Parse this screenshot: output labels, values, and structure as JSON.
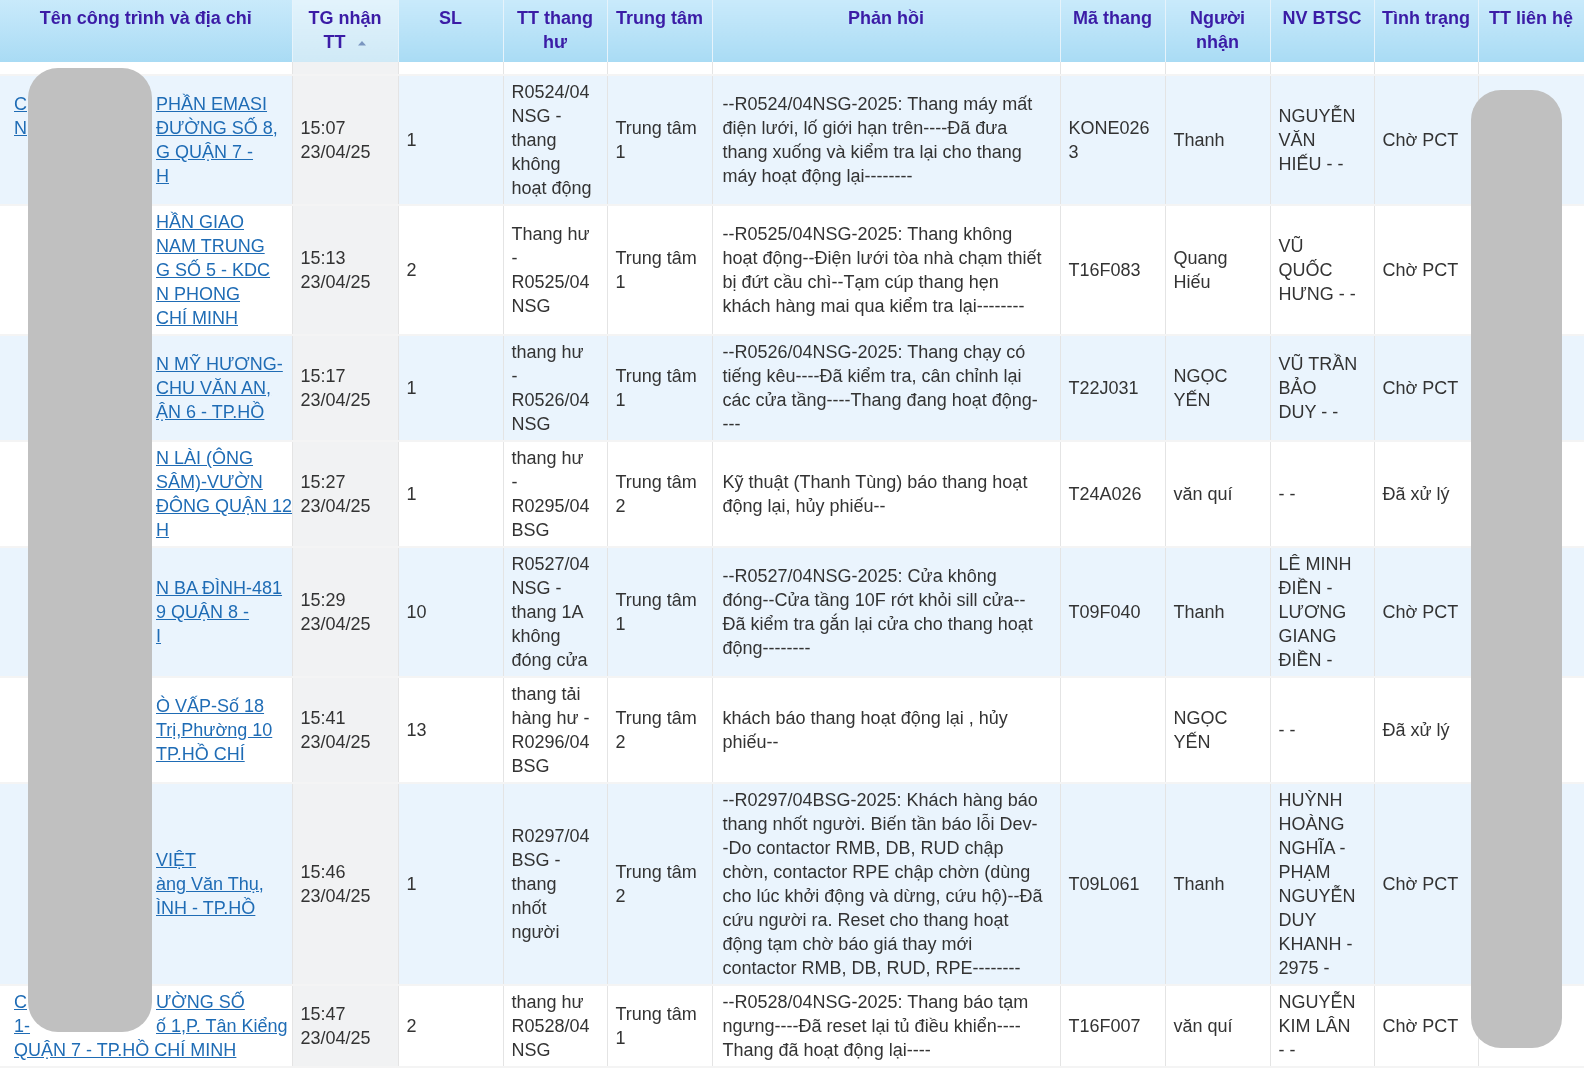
{
  "table": {
    "columns": [
      {
        "label": "Tên công trình và địa chỉ"
      },
      {
        "label": "TG nhận TT",
        "sorted": true
      },
      {
        "label": "SL"
      },
      {
        "label": "TT thang hư"
      },
      {
        "label": "Trung tâm"
      },
      {
        "label": "Phản hồi"
      },
      {
        "label": "Mã thang"
      },
      {
        "label": "Người nhận"
      },
      {
        "label": "NV BTSC"
      },
      {
        "label": "Tình trạng"
      },
      {
        "label": "TT liên hệ"
      }
    ],
    "rows": [
      {
        "address_lines": [
          {
            "left": "C",
            "right": "PHẦN EMASI"
          },
          {
            "left": "N",
            "right": "ĐƯỜNG SỐ 8,"
          },
          {
            "right": "G QUẬN 7 -"
          },
          {
            "right": "H"
          }
        ],
        "received": "15:07 23/04/25",
        "qty": "1",
        "elevator_status": "R0524/04 NSG - thang không hoạt động",
        "center": "Trung tâm 1",
        "feedback": "--R0524/04NSG-2025: Thang máy mất điện lưới, lố giới hạn trên----Đã đưa thang xuống và kiểm tra lại cho thang máy hoạt động lại--------",
        "elevator_code": "KONE0263",
        "receiver": "Thanh",
        "staff": "NGUYỄN VĂN HIẾU - -",
        "status": "Chờ PCT"
      },
      {
        "address_lines": [
          {
            "right": "HẦN GIAO"
          },
          {
            "right": "NAM TRUNG"
          },
          {
            "right": "G SỐ 5 - KDC"
          },
          {
            "right": "N PHONG"
          },
          {
            "right": "CHÍ MINH"
          }
        ],
        "received": "15:13 23/04/25",
        "qty": "2",
        "elevator_status": "Thang hư - R0525/04 NSG",
        "center": "Trung tâm 1",
        "feedback": "--R0525/04NSG-2025: Thang không hoạt động--Điện lưới tòa nhà chạm thiết bị đứt cầu chì--Tạm cúp thang hẹn khách hàng mai qua kiểm tra lại--------",
        "elevator_code": "T16F083",
        "receiver": "Quang Hiếu",
        "staff": "VŨ QUỐC HƯNG - -",
        "status": "Chờ PCT"
      },
      {
        "address_lines": [
          {
            "right": "N MỸ HƯƠNG-"
          },
          {
            "right": "CHU VĂN AN,"
          },
          {
            "right": "ẬN 6 - TP.HỒ"
          }
        ],
        "received": "15:17 23/04/25",
        "qty": "1",
        "elevator_status": "thang hư - R0526/04 NSG",
        "center": "Trung tâm 1",
        "feedback": "--R0526/04NSG-2025: Thang chạy có tiếng kêu----Đã kiểm tra, cân chỉnh lại các cửa tầng----Thang đang hoạt động----",
        "elevator_code": "T22J031",
        "receiver": "NGỌC YẾN",
        "staff": "VŨ TRẦN BẢO DUY - -",
        "status": "Chờ PCT"
      },
      {
        "address_lines": [
          {
            "right": "N LÀI (ÔNG"
          },
          {
            "right": "SÂM)-VƯỜN"
          },
          {
            "right": "ĐÔNG QUẬN 12"
          },
          {
            "right": "H"
          }
        ],
        "received": "15:27 23/04/25",
        "qty": "1",
        "elevator_status": "thang hư - R0295/04 BSG",
        "center": "Trung tâm 2",
        "feedback": "Kỹ thuật (Thanh Tùng) báo thang hoạt động lại, hủy phiếu--",
        "elevator_code": "T24A026",
        "receiver": "văn quí",
        "staff": "- -",
        "status": "Đã xử lý"
      },
      {
        "address_lines": [
          {
            "right": "N BA ĐÌNH-481"
          },
          {
            "right": "9 QUẬN 8 -"
          },
          {
            "right": "I"
          }
        ],
        "received": "15:29 23/04/25",
        "qty": "10",
        "elevator_status": "R0527/04 NSG - thang 1A không đóng cửa",
        "center": "Trung tâm 1",
        "feedback": "--R0527/04NSG-2025: Cửa không đóng--Cửa tầng 10F rớt khỏi sill cửa--Đã kiểm tra gắn lại cửa cho thang hoạt động--------",
        "elevator_code": "T09F040",
        "receiver": "Thanh",
        "staff": "LÊ MINH ĐIỀN - LƯƠNG GIANG ĐIỀN -",
        "status": "Chờ PCT"
      },
      {
        "address_lines": [
          {
            "right": "Ò VẤP-Số 18"
          },
          {
            "right": "Trị,Phường 10"
          },
          {
            "right": "TP.HỒ CHÍ"
          }
        ],
        "received": "15:41 23/04/25",
        "qty": "13",
        "elevator_status": "thang tải hàng hư - R0296/04 BSG",
        "center": "Trung tâm 2",
        "feedback": "khách báo thang hoạt động lại , hủy phiếu--",
        "receiver": "NGỌC YẾN",
        "staff": "- -",
        "status": "Đã xử lý"
      },
      {
        "address_lines": [
          {
            "right": "VIỆT"
          },
          {
            "right": "àng Văn Thụ,"
          },
          {
            "right": "ÌNH - TP.HỒ"
          }
        ],
        "received": "15:46 23/04/25",
        "qty": "1",
        "elevator_status": "R0297/04 BSG - thang nhốt người",
        "center": "Trung tâm 2",
        "feedback": "--R0297/04BSG-2025: Khách hàng báo thang nhốt người. Biến tần báo lỗi Dev--Do contactor RMB, DB, RUD chập chờn, contactor RPE chập chờn (dùng cho lúc khởi động và dừng, cứu hộ)--Đã cứu người ra. Reset cho thang hoạt động tạm chờ báo giá thay mới contactor RMB, DB, RUD, RPE--------",
        "elevator_code": "T09L061",
        "receiver": "Thanh",
        "staff": "HUỲNH HOÀNG NGHĨA - PHẠM NGUYỄN DUY KHANH - 2975 -",
        "status": "Chờ PCT"
      },
      {
        "address_lines": [
          {
            "left": "C",
            "right": "ƯỜNG SỐ"
          },
          {
            "left": "1-",
            "right": "ố 1,P. Tân Kiểng"
          },
          {
            "left": "QUẬN 7 - TP.HỒ CHÍ MINH"
          }
        ],
        "received": "15:47 23/04/25",
        "qty": "2",
        "elevator_status": "thang hư R0528/04 NSG",
        "center": "Trung tâm 1",
        "feedback": "--R0528/04NSG-2025: Thang báo tạm ngưng----Đã reset lại tủ điều khiển----Thang đã hoạt động lại----",
        "elevator_code": "T16F007",
        "receiver": "văn quí",
        "staff": "NGUYỄN KIM LÂN - -",
        "status": "Chờ PCT"
      }
    ]
  }
}
